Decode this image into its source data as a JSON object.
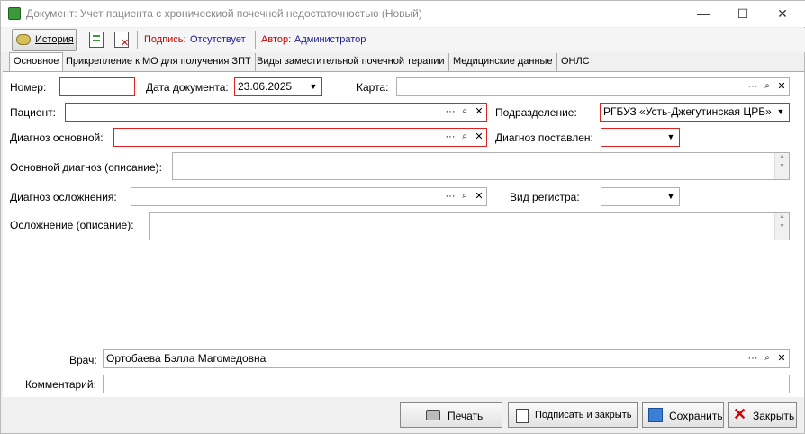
{
  "window": {
    "title": "Документ: Учет пациента с хроническиой почечной недостаточностью (Новый)",
    "minimize": "—",
    "maximize": "☐",
    "close": "✕"
  },
  "toolbar": {
    "history_label": "История",
    "sign_label": "Подпись:",
    "sign_value": "Отсутствует",
    "author_label": "Автор:",
    "author_value": "Администратор"
  },
  "tabs": [
    {
      "label": "Основное"
    },
    {
      "label": "Прикрепление к МО для получения ЗПТ"
    },
    {
      "label": "Виды заместительной почечной терапии"
    },
    {
      "label": "Медицинские данные"
    },
    {
      "label": "ОНЛС"
    }
  ],
  "form": {
    "number_label": "Номер:",
    "number_value": "",
    "doc_date_label": "Дата документа:",
    "doc_date_value": "23.06.2025",
    "card_label": "Карта:",
    "card_value": "",
    "patient_label": "Пациент:",
    "patient_value": "",
    "department_label": "Подразделение:",
    "department_value": "РГБУЗ «Усть-Джегутинская ЦРБ»",
    "main_diag_label": "Диагноз основной:",
    "main_diag_value": "",
    "diag_set_label": "Диагноз поставлен:",
    "diag_set_value": "",
    "main_diag_desc_label": "Основной диагноз (описание):",
    "complication_diag_label": "Диагноз осложнения:",
    "registry_type_label": "Вид регистра:",
    "complication_desc_label": "Осложнение (описание):",
    "doctor_label": "Врач:",
    "doctor_value": "Ортобаева Бэлла Магомедовна",
    "comment_label": "Комментарий:",
    "comment_value": ""
  },
  "buttons": {
    "print": "Печать",
    "sign_close": "Подписать и закрыть",
    "save": "Сохранить",
    "close": "Закрыть"
  },
  "icons": {
    "ellipsis": "···",
    "search": "🔍",
    "clear": "✕",
    "dropdown": "▼",
    "scroll_up": "▲",
    "scroll_down": "▼"
  },
  "colors": {
    "required_border": "#dd2222",
    "sign_label": "#c00000",
    "link_blue": "#1a1a8c"
  }
}
